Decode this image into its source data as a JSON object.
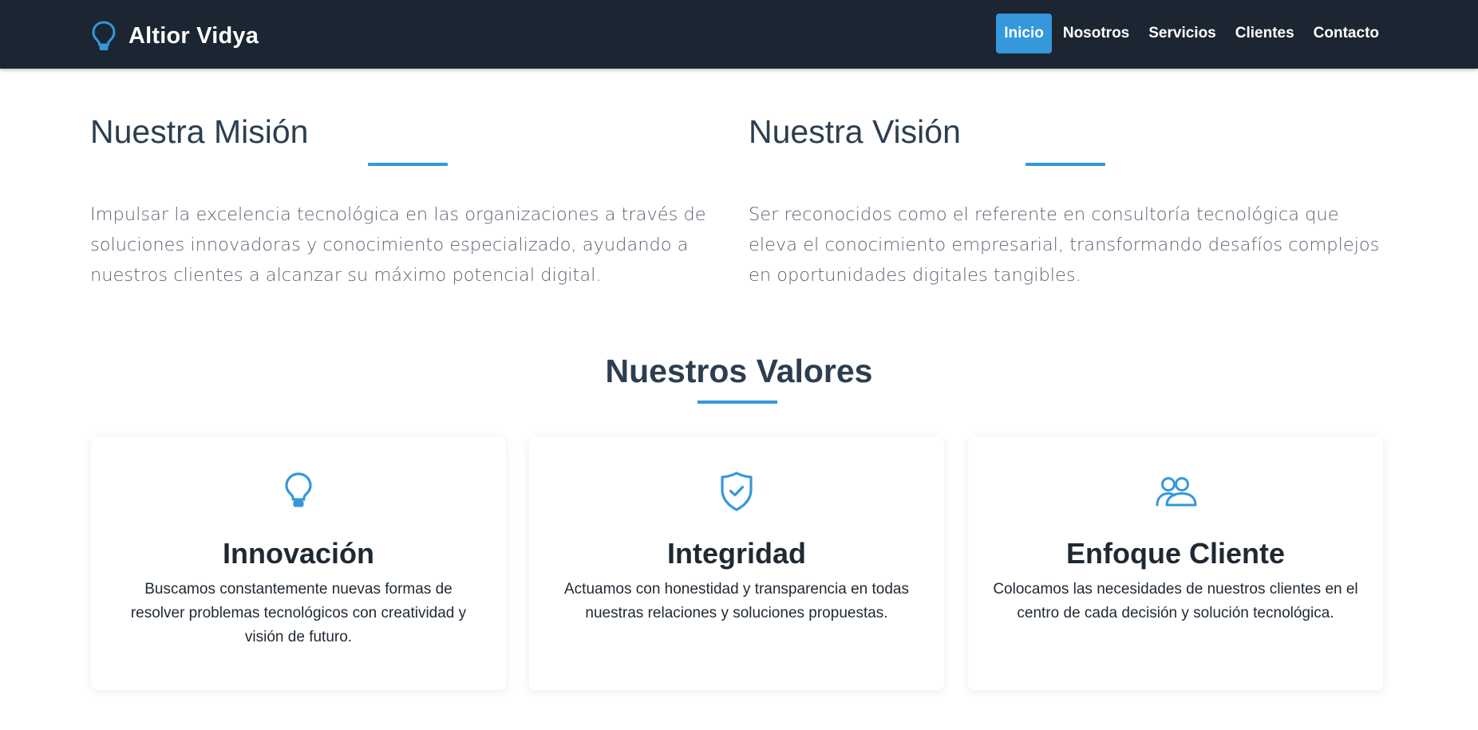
{
  "colors": {
    "navbar_bg": "#1c2532",
    "accent": "#3498db",
    "heading": "#2c3e50",
    "body_text": "#5a6472"
  },
  "brand": {
    "name": "Altior Vidya",
    "icon": "lightbulb-icon"
  },
  "nav": {
    "items": [
      {
        "label": "Inicio",
        "active": true
      },
      {
        "label": "Nosotros",
        "active": false
      },
      {
        "label": "Servicios",
        "active": false
      },
      {
        "label": "Clientes",
        "active": false
      },
      {
        "label": "Contacto",
        "active": false
      }
    ]
  },
  "mission": {
    "title": "Nuestra Misión",
    "text": "Impulsar la excelencia tecnológica en las organizaciones a través de soluciones innovadoras y conocimiento especializado, ayudando a nuestros clientes a alcanzar su máximo potencial digital."
  },
  "vision": {
    "title": "Nuestra Visión",
    "text": "Ser reconocidos como el referente en consultoría tecnológica que eleva el conocimiento empresarial, transformando desafíos complejos en oportunidades digitales tangibles."
  },
  "values": {
    "title": "Nuestros Valores",
    "cards": [
      {
        "icon": "lightbulb-icon",
        "title": "Innovación",
        "text": "Buscamos constantemente nuevas formas de resolver problemas tecnológicos con creatividad y visión de futuro."
      },
      {
        "icon": "shield-check-icon",
        "title": "Integridad",
        "text": "Actuamos con honestidad y transparencia en todas nuestras relaciones y soluciones propuestas."
      },
      {
        "icon": "people-icon",
        "title": "Enfoque Cliente",
        "text": "Colocamos las necesidades de nuestros clientes en el centro de cada decisión y solución tecnológica."
      }
    ]
  }
}
